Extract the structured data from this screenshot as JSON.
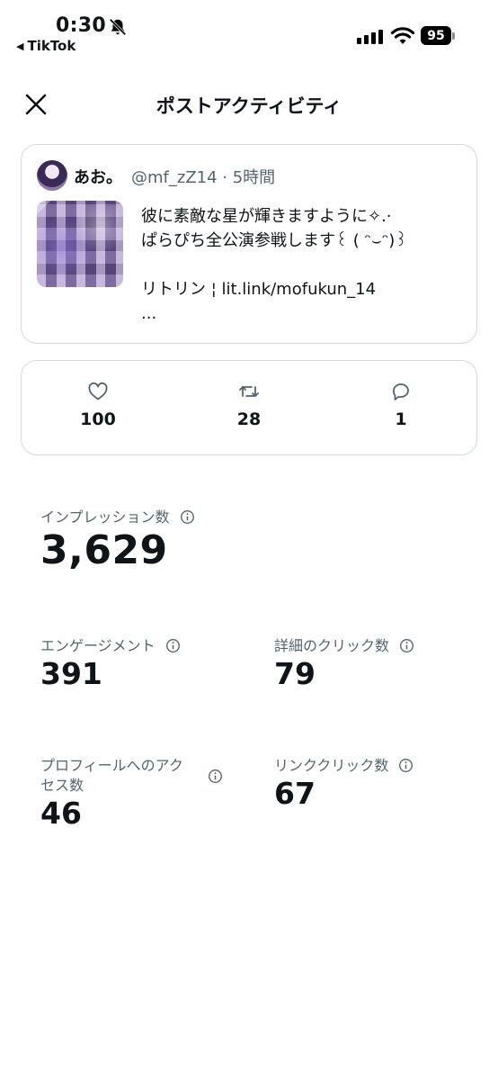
{
  "status_bar": {
    "time": "0:30",
    "back_app": "TikTok",
    "battery": "95"
  },
  "header": {
    "title": "ポストアクティビティ"
  },
  "post": {
    "display_name": "あお。",
    "handle_time": "@mf_zZ14 · 5時間",
    "lines": [
      "彼に素敵な星が輝きますように✧.·",
      "ぱらぴち全公演参戦します꒰ ( ᵔ⌣ᵔ)꒱",
      "リトリン ¦ lit.link/mofukun_14",
      "..."
    ]
  },
  "engagement": {
    "likes": "100",
    "reposts": "28",
    "replies": "1"
  },
  "metrics": {
    "impressions": {
      "label": "インプレッション数",
      "value": "3,629"
    },
    "engagements": {
      "label": "エンゲージメント",
      "value": "391"
    },
    "detail_clicks": {
      "label": "詳細のクリック数",
      "value": "79"
    },
    "profile_visits": {
      "label_line1": "プロフィールへのアク",
      "label_line2": "セス数",
      "value": "46"
    },
    "link_clicks": {
      "label": "リンククリック数",
      "value": "67"
    }
  },
  "icons": [
    "bell-off-icon",
    "signal-icon",
    "wifi-icon",
    "battery-icon",
    "close-icon",
    "heart-icon",
    "repost-icon",
    "reply-icon",
    "info-icon"
  ]
}
